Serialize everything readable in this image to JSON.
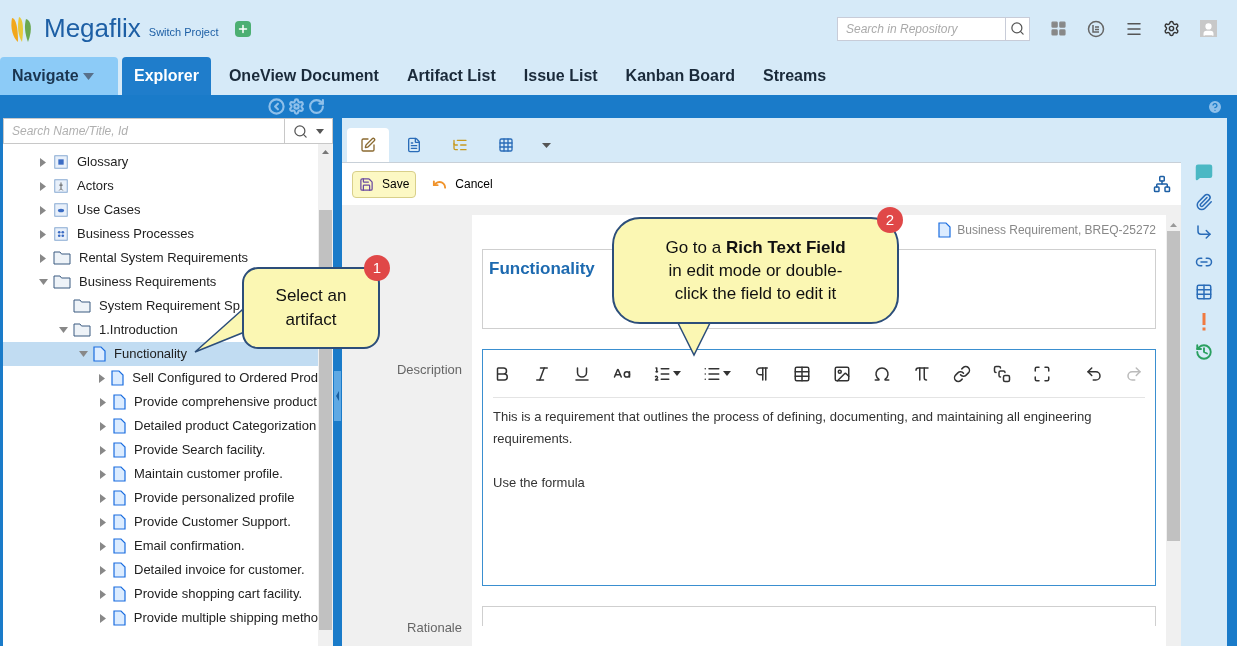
{
  "header": {
    "logo_text": "Megaflix",
    "switch_project": "Switch Project",
    "search": {
      "placeholder": "Search in Repository"
    }
  },
  "navigate_menu": {
    "label": "Navigate"
  },
  "nav_tabs": [
    {
      "label": "Explorer",
      "kind": "tab",
      "selected": true
    },
    {
      "label": "OneView Document",
      "kind": "tab",
      "selected": false
    },
    {
      "label": "Artifact List",
      "kind": "tab",
      "selected": false
    },
    {
      "label": "Issue List",
      "kind": "tab",
      "selected": false
    },
    {
      "label": "Kanban Board",
      "kind": "tab",
      "selected": false
    },
    {
      "label": "Streams",
      "kind": "tab",
      "selected": false
    }
  ],
  "tree": {
    "search": {
      "placeholder": "Search Name/Title, Id"
    },
    "items": [
      {
        "label": "Glossary",
        "kind": "glossary",
        "expandable": true,
        "expanded": false,
        "selected": false
      },
      {
        "label": "Actors",
        "kind": "actors",
        "expandable": true,
        "expanded": false,
        "selected": false
      },
      {
        "label": "Use Cases",
        "kind": "usecases",
        "expandable": true,
        "expanded": false,
        "selected": false
      },
      {
        "label": "Business Processes",
        "kind": "processes",
        "expandable": true,
        "expanded": false,
        "selected": false
      },
      {
        "label": "Rental System Requirements",
        "kind": "folder",
        "expandable": true,
        "expanded": false,
        "selected": false
      },
      {
        "label": "Business Requirements",
        "kind": "folder",
        "expandable": true,
        "expanded": true,
        "selected": false,
        "children": [
          {
            "label": "System Requirement Sp",
            "kind": "folder",
            "expandable": false,
            "selected": false
          },
          {
            "label": "1.Introduction",
            "kind": "folder",
            "expandable": true,
            "expanded": true,
            "selected": false,
            "children": [
              {
                "label": "Functionality",
                "kind": "document",
                "expandable": true,
                "expanded": true,
                "selected": true,
                "children": [
                  {
                    "label": "Sell Configured to Ordered Prod",
                    "kind": "document",
                    "expandable": true,
                    "expanded": false,
                    "selected": false
                  },
                  {
                    "label": "Provide comprehensive product",
                    "kind": "document",
                    "expandable": true,
                    "expanded": false,
                    "selected": false
                  },
                  {
                    "label": "Detailed product Categorization",
                    "kind": "document",
                    "expandable": true,
                    "expanded": false,
                    "selected": false
                  },
                  {
                    "label": "Provide Search facility.",
                    "kind": "document",
                    "expandable": true,
                    "expanded": false,
                    "selected": false
                  },
                  {
                    "label": "Maintain customer profile.",
                    "kind": "document",
                    "expandable": true,
                    "expanded": false,
                    "selected": false
                  },
                  {
                    "label": "Provide personalized profile",
                    "kind": "document",
                    "expandable": true,
                    "expanded": false,
                    "selected": false
                  },
                  {
                    "label": "Provide Customer Support.",
                    "kind": "document",
                    "expandable": true,
                    "expanded": false,
                    "selected": false
                  },
                  {
                    "label": "Email confirmation.",
                    "kind": "document",
                    "expandable": true,
                    "expanded": false,
                    "selected": false
                  },
                  {
                    "label": "Detailed invoice for customer.",
                    "kind": "document",
                    "expandable": true,
                    "expanded": false,
                    "selected": false
                  },
                  {
                    "label": "Provide shopping cart facility.",
                    "kind": "document",
                    "expandable": true,
                    "expanded": false,
                    "selected": false
                  },
                  {
                    "label": "Provide multiple shipping metho",
                    "kind": "document",
                    "expandable": true,
                    "expanded": false,
                    "selected": false
                  }
                ]
              }
            ]
          }
        ]
      }
    ]
  },
  "editor": {
    "view_tabs": [
      {
        "kind": "edit",
        "selected": true
      },
      {
        "kind": "document",
        "selected": false
      },
      {
        "kind": "tree",
        "selected": false
      },
      {
        "kind": "grid",
        "selected": false
      }
    ],
    "save": "Save",
    "cancel": "Cancel",
    "artifact_ref": "Business Requirement, BREQ-25272",
    "name": "Functionality",
    "description_label": "Description",
    "description_paragraphs": [
      "This is a requirement that outlines the process of defining, documenting, and maintaining all engineering requirements.",
      "Use the formula"
    ],
    "rationale_label": "Rationale"
  },
  "callouts": [
    {
      "number": "1",
      "text": "Select an artifact"
    },
    {
      "number": "2",
      "text": "Go to a **Rich Text Field** in edit mode or double-click the field to edit it"
    }
  ]
}
